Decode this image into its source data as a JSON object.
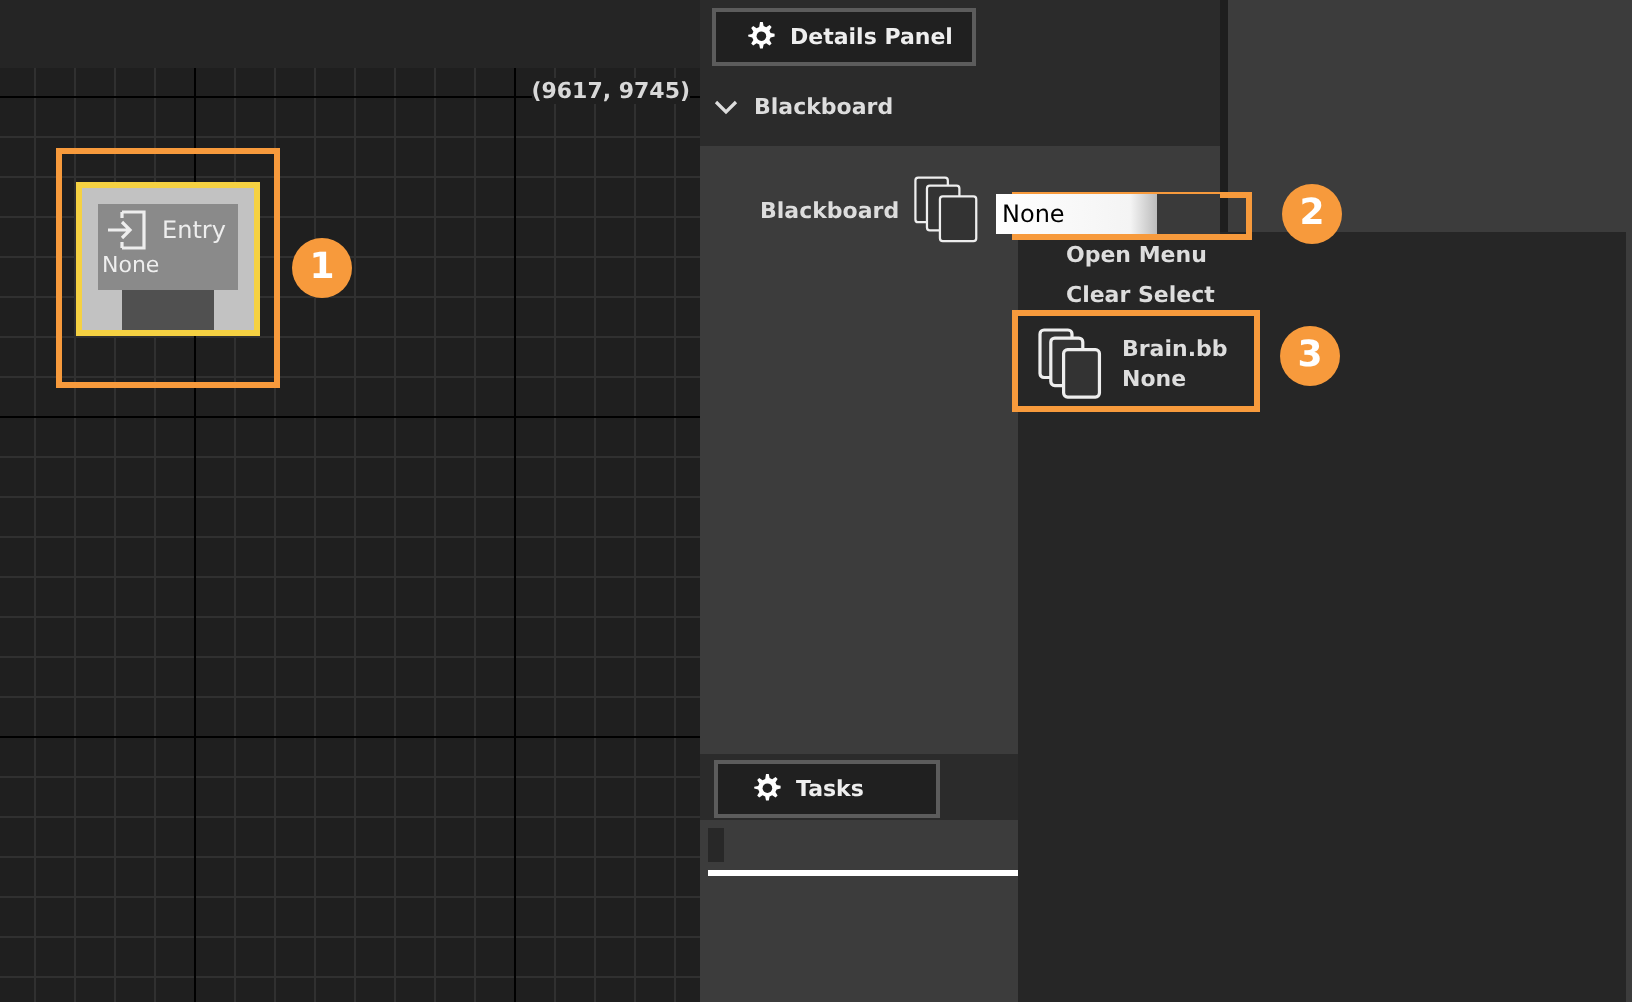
{
  "canvas": {
    "coordinates": "(9617, 9745)",
    "node": {
      "title": "Entry",
      "value": "None",
      "selected": true
    }
  },
  "details_panel": {
    "tab": "Details Panel",
    "section": {
      "title": "Blackboard",
      "expanded": true
    },
    "field": {
      "label": "Blackboard",
      "value": "None"
    }
  },
  "dropdown": {
    "items": [
      {
        "kind": "action",
        "label": "Open Menu"
      },
      {
        "kind": "action",
        "label": "Clear Select"
      },
      {
        "kind": "asset",
        "name": "Brain.bb",
        "subtitle": "None"
      }
    ]
  },
  "tasks_panel": {
    "tab": "Tasks"
  },
  "callouts": [
    {
      "number": "1"
    },
    {
      "number": "2"
    },
    {
      "number": "3"
    }
  ]
}
